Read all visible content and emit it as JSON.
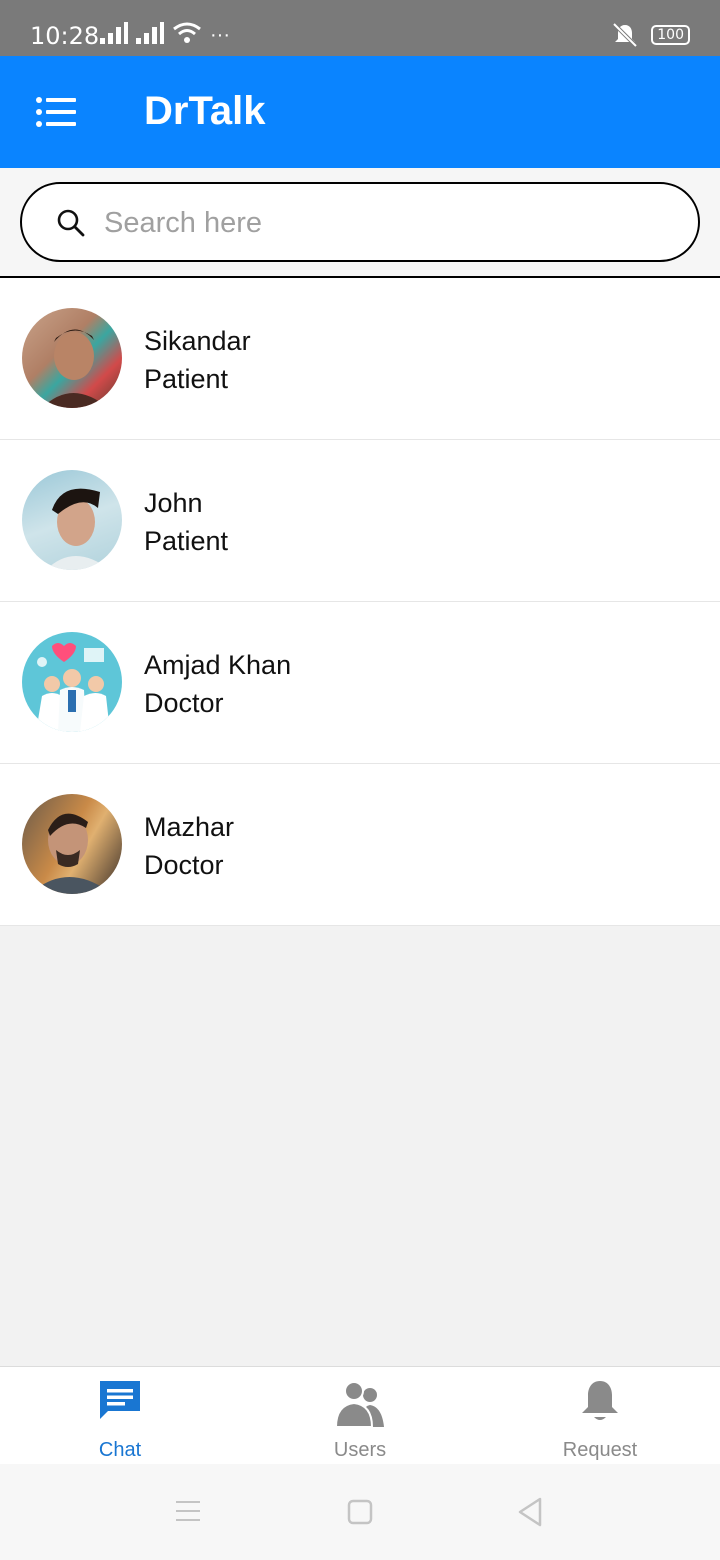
{
  "status": {
    "time": "10:28",
    "battery": "100",
    "more": "···"
  },
  "app": {
    "title": "DrTalk",
    "brand_color": "#0a84ff"
  },
  "search": {
    "placeholder": "Search here",
    "value": ""
  },
  "chats": [
    {
      "name": "Sikandar",
      "role": "Patient"
    },
    {
      "name": "John",
      "role": "Patient"
    },
    {
      "name": "Amjad Khan",
      "role": "Doctor"
    },
    {
      "name": "Mazhar",
      "role": "Doctor"
    }
  ],
  "nav": {
    "chat": "Chat",
    "users": "Users",
    "request": "Request",
    "active_color": "#1976d2",
    "inactive_color": "#8a8a8a"
  },
  "icons": {
    "menu": "menu-icon",
    "search": "search-icon",
    "chat": "chat-icon",
    "users": "users-icon",
    "request": "bell-icon"
  }
}
